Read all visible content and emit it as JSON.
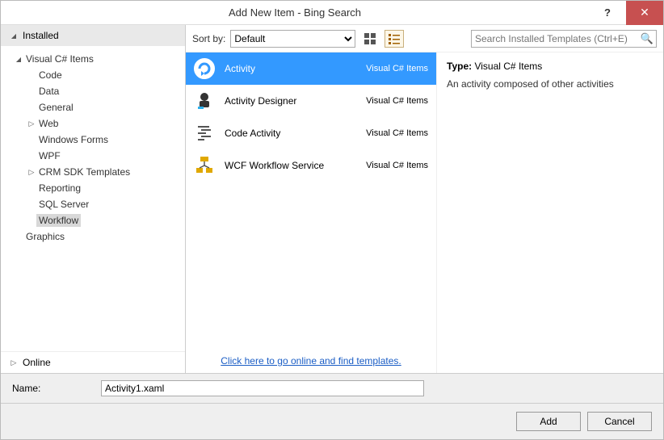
{
  "title": "Add New Item - Bing Search",
  "sidebar": {
    "header": "Installed",
    "tree": {
      "root": "Visual C# Items",
      "items": [
        "Code",
        "Data",
        "General",
        "Web",
        "Windows Forms",
        "WPF",
        "CRM SDK Templates",
        "Reporting",
        "SQL Server",
        "Workflow"
      ],
      "extra": "Graphics"
    },
    "footer": "Online"
  },
  "toolbar": {
    "sort_label": "Sort by:",
    "sort_value": "Default",
    "search_placeholder": "Search Installed Templates (Ctrl+E)"
  },
  "templates": [
    {
      "name": "Activity",
      "category": "Visual C# Items",
      "selected": true
    },
    {
      "name": "Activity Designer",
      "category": "Visual C# Items"
    },
    {
      "name": "Code Activity",
      "category": "Visual C# Items"
    },
    {
      "name": "WCF Workflow Service",
      "category": "Visual C# Items"
    }
  ],
  "online_link": "Click here to go online and find templates.",
  "details": {
    "type_label": "Type:",
    "type_value": "Visual C# Items",
    "description": "An activity composed of other activities"
  },
  "name_row": {
    "label": "Name:",
    "value": "Activity1.xaml"
  },
  "buttons": {
    "add": "Add",
    "cancel": "Cancel"
  }
}
